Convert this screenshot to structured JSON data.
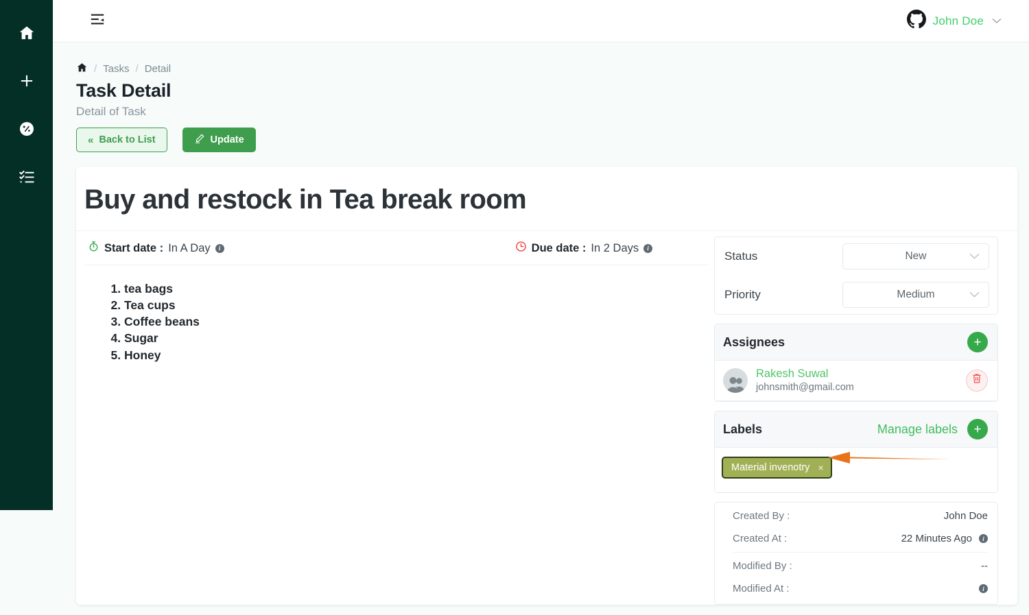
{
  "rail": {
    "items": [
      {
        "name": "home-icon",
        "label": "Home"
      },
      {
        "name": "plus-icon",
        "label": "Add"
      },
      {
        "name": "dashboard-icon",
        "label": "Dashboard"
      },
      {
        "name": "checklist-icon",
        "label": "Tasks"
      }
    ]
  },
  "topbar": {
    "fold_icon": "menu-fold-icon",
    "brand_icon": "github-icon",
    "user_name": "John Doe",
    "caret": "⌄"
  },
  "breadcrumb": {
    "home_icon": "home-icon",
    "sep": "/",
    "items": [
      "Tasks",
      "Detail"
    ]
  },
  "header": {
    "title": "Task Detail",
    "subtitle": "Detail of Task",
    "back_label": "Back to List",
    "back_icon": "«",
    "update_label": "Update",
    "update_icon": "pencil-icon"
  },
  "task": {
    "title": "Buy and restock in Tea break room",
    "start_label": "Start date :",
    "start_value": "In A Day",
    "due_label": "Due date :",
    "due_value": "In 2 Days",
    "description_items": [
      "tea bags",
      "Tea cups",
      "Coffee beans",
      "Sugar",
      "Honey"
    ]
  },
  "fields": {
    "status_label": "Status",
    "status_value": "New",
    "priority_label": "Priority",
    "priority_value": "Medium"
  },
  "assignees": {
    "title": "Assignees",
    "add_label": "+",
    "list": [
      {
        "name": "Rakesh Suwal",
        "email": "johnsmith@gmail.com"
      }
    ]
  },
  "labels": {
    "title": "Labels",
    "manage_label": "Manage labels",
    "add_label": "+",
    "chips": [
      {
        "text": "Material invenotry",
        "close": "×"
      }
    ]
  },
  "meta": {
    "rows": [
      {
        "key": "Created By :",
        "value": "John Doe",
        "info": false
      },
      {
        "key": "Created At :",
        "value": "22 Minutes Ago",
        "info": true
      },
      {
        "key": "Modified By :",
        "value": "--",
        "info": false
      },
      {
        "key": "Modified At :",
        "value": "",
        "info": true
      }
    ]
  },
  "colors": {
    "rail_bg": "#042f26",
    "primary_green": "#3f9e4d",
    "accent_green": "#3ecf6b",
    "label_chip": "#a2b055",
    "arrow": "#e8731a",
    "danger": "#ef5350",
    "page_bg": "#f7fbfa"
  }
}
